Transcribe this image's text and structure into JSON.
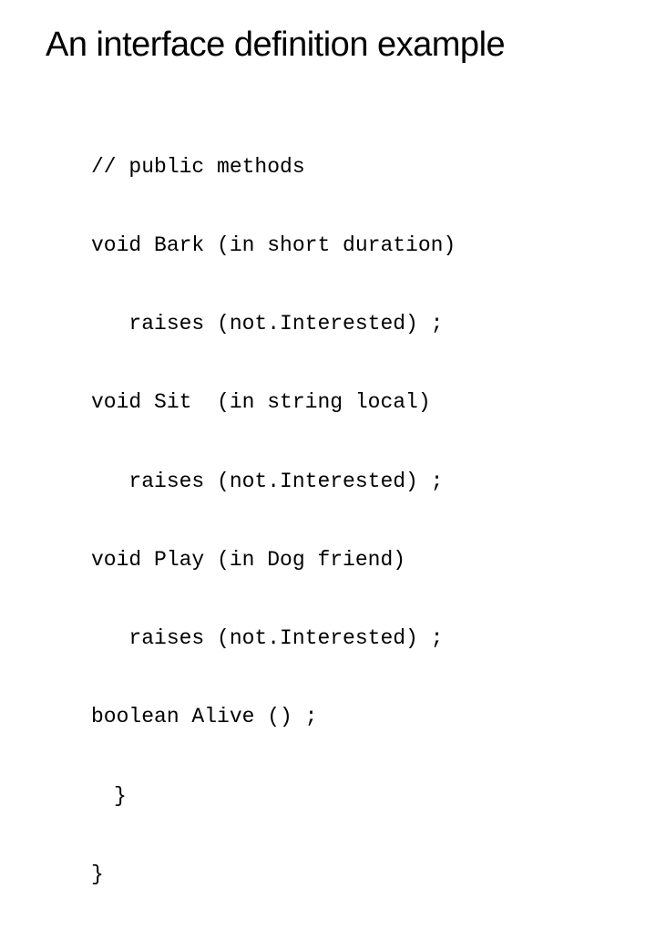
{
  "slide": {
    "title": "An interface definition example",
    "code": {
      "line1": "// public methods",
      "line2": "void Bark (in short duration)",
      "line3": "   raises (not.Interested) ;",
      "line4": "void Sit  (in string local)",
      "line5": "   raises (not.Interested) ;",
      "line6": "void Play (in Dog friend)",
      "line7": "   raises (not.Interested) ;",
      "line8": "boolean Alive () ;",
      "line9": "}",
      "line10": "}"
    }
  }
}
